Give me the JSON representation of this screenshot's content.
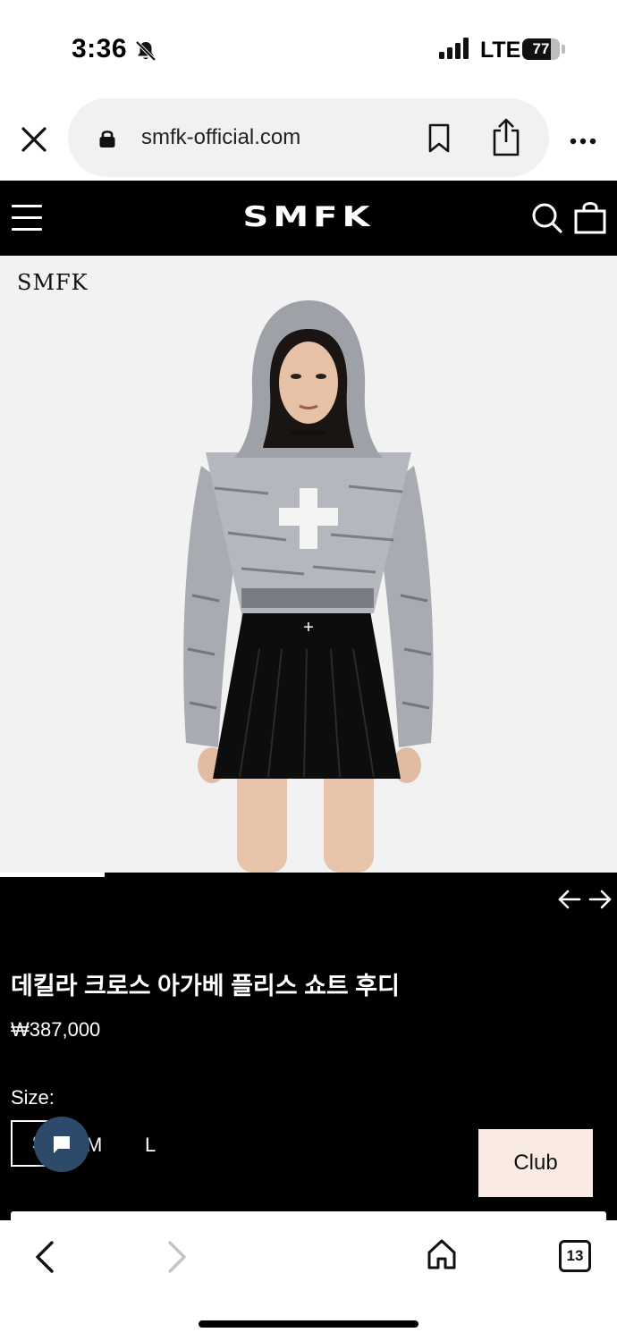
{
  "status_bar": {
    "time": "3:36",
    "network": "LTE",
    "battery_level": 77,
    "battery_text": "77",
    "icons": [
      "bell-slash-icon",
      "signal-bars-icon",
      "battery-icon"
    ]
  },
  "browser": {
    "url": "smfk-official.com",
    "icons": [
      "close-icon",
      "lock-icon",
      "bookmark-icon",
      "share-icon",
      "more-icon"
    ]
  },
  "site_header": {
    "logo": "SMFK",
    "icons": [
      "menu-icon",
      "search-icon",
      "shopping-bag-icon"
    ]
  },
  "hero": {
    "brand_tag": "SMFK",
    "carousel_progress": 0.17,
    "icons": [
      "arrow-left-icon",
      "arrow-right-icon"
    ]
  },
  "product": {
    "title": "데킬라 크로스 아가베 플리스 쇼트 후디",
    "price": "₩387,000",
    "size_label": "Size:",
    "sizes": [
      "S",
      "M",
      "L"
    ],
    "selected_size": "S",
    "club_button": "Club",
    "icons": [
      "chat-icon"
    ]
  },
  "toolbar": {
    "tab_count": "13",
    "icons": [
      "back-icon",
      "forward-icon",
      "home-icon",
      "tabs-icon"
    ]
  },
  "colors": {
    "header_bg": "#000000",
    "club_button_bg": "#faeae4",
    "chat_button_bg": "#2d4a6b",
    "url_pill_bg": "#f1f1f3"
  }
}
